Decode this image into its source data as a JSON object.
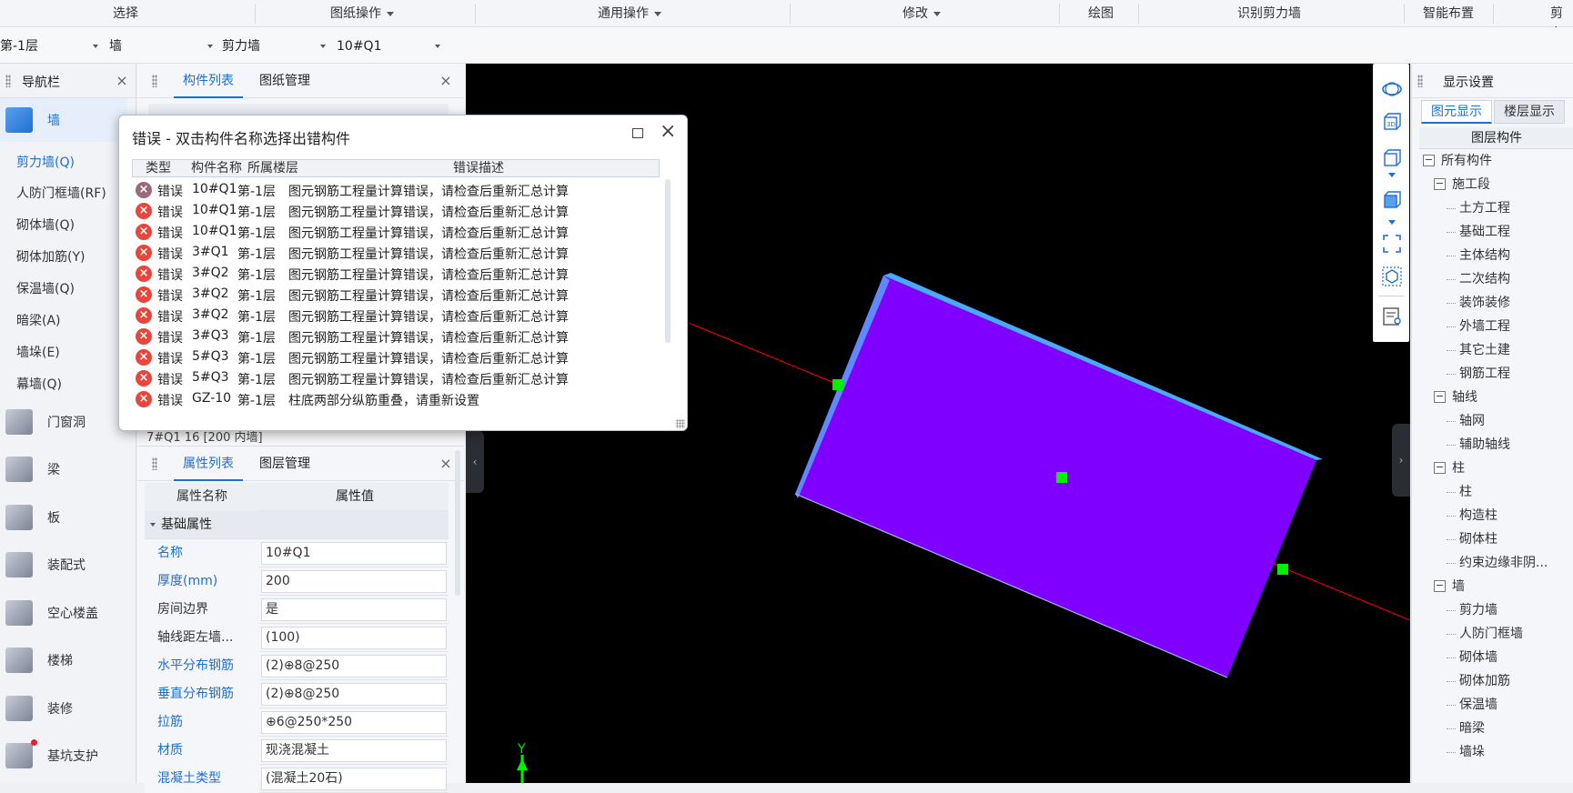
{
  "ribbon": {
    "groups": [
      "选择",
      "图纸操作",
      "通用操作",
      "修改",
      "绘图",
      "识别剪力墙",
      "智能布置",
      "剪力"
    ]
  },
  "selectors": {
    "floor": "第-1层",
    "category": "墙",
    "type": "剪力墙",
    "component": "10#Q1"
  },
  "nav": {
    "title": "导航栏",
    "categories": [
      {
        "label": "墙",
        "icon": "wall-icon",
        "color": "#1f6fd1"
      },
      {
        "label": "门窗洞",
        "icon": "door-window-icon"
      },
      {
        "label": "梁",
        "icon": "beam-icon"
      },
      {
        "label": "板",
        "icon": "slab-icon"
      },
      {
        "label": "装配式",
        "icon": "prefab-icon"
      },
      {
        "label": "空心楼盖",
        "icon": "hollow-floor-icon"
      },
      {
        "label": "楼梯",
        "icon": "stairs-icon"
      },
      {
        "label": "装修",
        "icon": "decoration-icon"
      },
      {
        "label": "基坑支护",
        "icon": "pit-support-icon"
      }
    ],
    "wall_items": [
      "剪力墙(Q)",
      "人防门框墙(RF)",
      "砌体墙(Q)",
      "砌体加筋(Y)",
      "保温墙(Q)",
      "暗梁(A)",
      "墙垛(E)",
      "幕墙(Q)"
    ]
  },
  "component_panel": {
    "tabs": [
      "构件列表",
      "图纸管理"
    ],
    "partial_row": "7#Q1   16    [200 内墙]"
  },
  "property_panel": {
    "tabs": [
      "属性列表",
      "图层管理"
    ],
    "col_name": "属性名称",
    "col_value": "属性值",
    "group": "基础属性",
    "rows": [
      {
        "name": "名称",
        "value": "10#Q1",
        "highlight": true
      },
      {
        "name": "厚度(mm)",
        "value": "200",
        "highlight": true
      },
      {
        "name": "房间边界",
        "value": "是",
        "highlight": false
      },
      {
        "name": "轴线距左墙...",
        "value": "(100)",
        "highlight": false
      },
      {
        "name": "水平分布钢筋",
        "value": "(2)⊕8@250",
        "highlight": true
      },
      {
        "name": "垂直分布钢筋",
        "value": "(2)⊕8@250",
        "highlight": true
      },
      {
        "name": "拉筋",
        "value": "⊕6@250*250",
        "highlight": true
      },
      {
        "name": "材质",
        "value": "现浇混凝土",
        "highlight": true
      },
      {
        "name": "混凝土类型",
        "value": "(混凝土20石)",
        "highlight": true
      }
    ]
  },
  "display_panel": {
    "title": "显示设置",
    "tabs": [
      "图元显示",
      "楼层显示"
    ],
    "col_header": "图层构件",
    "tree": [
      {
        "label": "所有构件",
        "level": 0,
        "expand": true
      },
      {
        "label": "施工段",
        "level": 1,
        "expand": true
      },
      {
        "label": "土方工程",
        "level": 2
      },
      {
        "label": "基础工程",
        "level": 2
      },
      {
        "label": "主体结构",
        "level": 2
      },
      {
        "label": "二次结构",
        "level": 2
      },
      {
        "label": "装饰装修",
        "level": 2
      },
      {
        "label": "外墙工程",
        "level": 2
      },
      {
        "label": "其它土建",
        "level": 2
      },
      {
        "label": "钢筋工程",
        "level": 2
      },
      {
        "label": "轴线",
        "level": 1,
        "expand": true
      },
      {
        "label": "轴网",
        "level": 2
      },
      {
        "label": "辅助轴线",
        "level": 2
      },
      {
        "label": "柱",
        "level": 1,
        "expand": true
      },
      {
        "label": "柱",
        "level": 2
      },
      {
        "label": "构造柱",
        "level": 2
      },
      {
        "label": "砌体柱",
        "level": 2
      },
      {
        "label": "约束边缘非阴...",
        "level": 2
      },
      {
        "label": "墙",
        "level": 1,
        "expand": true
      },
      {
        "label": "剪力墙",
        "level": 2
      },
      {
        "label": "人防门框墙",
        "level": 2
      },
      {
        "label": "砌体墙",
        "level": 2
      },
      {
        "label": "砌体加筋",
        "level": 2
      },
      {
        "label": "保温墙",
        "level": 2
      },
      {
        "label": "暗梁",
        "level": 2
      },
      {
        "label": "墙垛",
        "level": 2
      }
    ]
  },
  "error_dialog": {
    "title": "错误 - 双击构件名称选择出错构件",
    "columns": [
      "类型",
      "构件名称",
      "所属楼层",
      "错误描述"
    ],
    "rows": [
      {
        "type": "错误",
        "name": "10#Q1",
        "floor": "第-1层",
        "desc": "图元钢筋工程量计算错误，请检查后重新汇总计算"
      },
      {
        "type": "错误",
        "name": "10#Q1",
        "floor": "第-1层",
        "desc": "图元钢筋工程量计算错误，请检查后重新汇总计算"
      },
      {
        "type": "错误",
        "name": "10#Q1",
        "floor": "第-1层",
        "desc": "图元钢筋工程量计算错误，请检查后重新汇总计算"
      },
      {
        "type": "错误",
        "name": "3#Q1",
        "floor": "第-1层",
        "desc": "图元钢筋工程量计算错误，请检查后重新汇总计算"
      },
      {
        "type": "错误",
        "name": "3#Q2",
        "floor": "第-1层",
        "desc": "图元钢筋工程量计算错误，请检查后重新汇总计算"
      },
      {
        "type": "错误",
        "name": "3#Q2",
        "floor": "第-1层",
        "desc": "图元钢筋工程量计算错误，请检查后重新汇总计算"
      },
      {
        "type": "错误",
        "name": "3#Q2",
        "floor": "第-1层",
        "desc": "图元钢筋工程量计算错误，请检查后重新汇总计算"
      },
      {
        "type": "错误",
        "name": "3#Q3",
        "floor": "第-1层",
        "desc": "图元钢筋工程量计算错误，请检查后重新汇总计算"
      },
      {
        "type": "错误",
        "name": "5#Q3",
        "floor": "第-1层",
        "desc": "图元钢筋工程量计算错误，请检查后重新汇总计算"
      },
      {
        "type": "错误",
        "name": "5#Q3",
        "floor": "第-1层",
        "desc": "图元钢筋工程量计算错误，请检查后重新汇总计算"
      },
      {
        "type": "错误",
        "name": "GZ-10",
        "floor": "第-1层",
        "desc": "柱底两部分纵筋重叠，请重新设置"
      }
    ]
  },
  "viewport": {
    "axis_label": "Y",
    "wall_color": "#7f00ff",
    "axis_color": "#e00000",
    "grip_color": "#00ee00"
  }
}
